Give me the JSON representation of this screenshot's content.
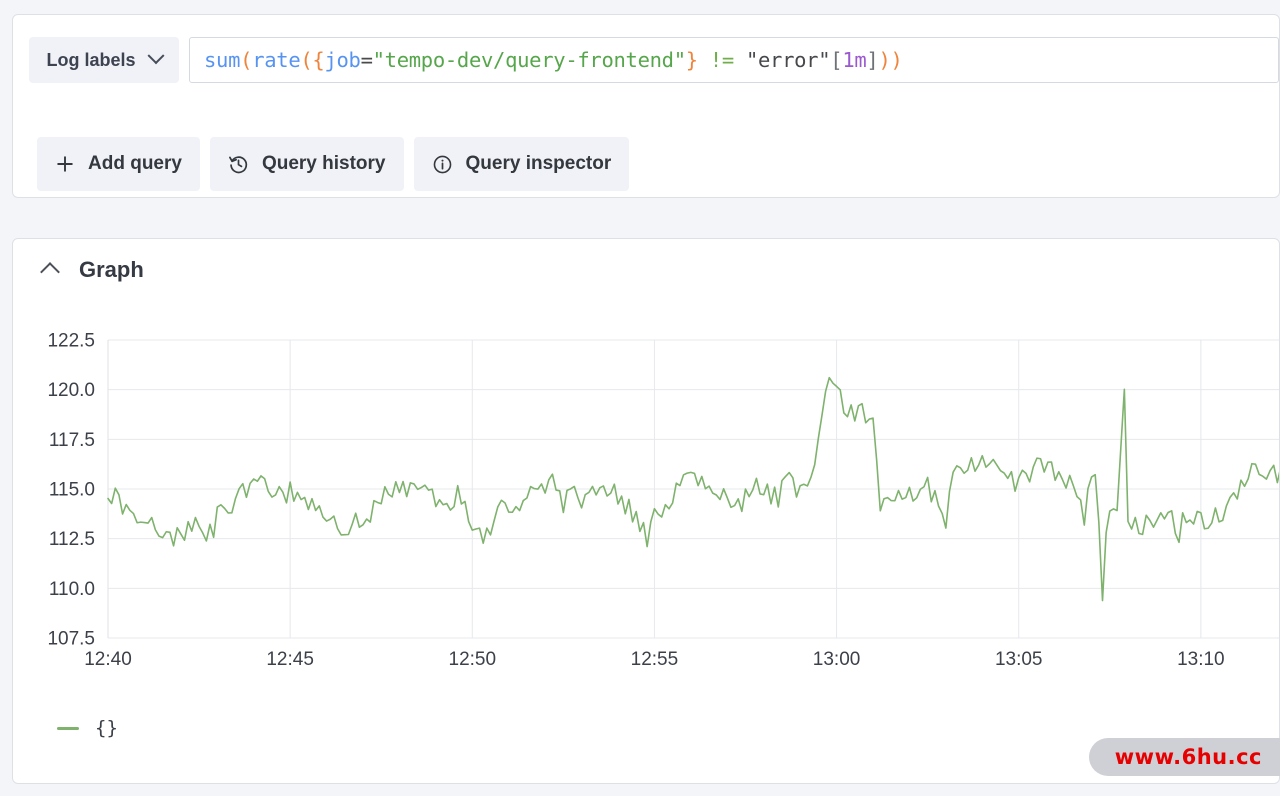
{
  "query_panel": {
    "log_labels_button": "Log labels",
    "chevron_icon": "chevron-down-icon",
    "expression": {
      "full": "sum(rate({job=\"tempo-dev/query-frontend\"} != \"error\"[1m]))",
      "tokens": {
        "sum": "sum",
        "open1": "(",
        "rate": "rate",
        "open2": "(",
        "brace_open": "{",
        "label": "job",
        "eq": "=",
        "value": "\"tempo-dev/query-frontend\"",
        "brace_close": "}",
        "neq": "!=",
        "error_str": "\"error\"",
        "bracket_open": "[",
        "duration": "1m",
        "bracket_close": "]",
        "close": "))"
      }
    },
    "buttons": [
      {
        "label": "Add query",
        "icon": "plus-icon"
      },
      {
        "label": "Query history",
        "icon": "history-clock-icon"
      },
      {
        "label": "Query inspector",
        "icon": "info-circle-icon"
      }
    ]
  },
  "graph_panel": {
    "title": "Graph",
    "collapse_icon": "chevron-up-icon",
    "legend": [
      {
        "label": "{}",
        "color": "#7eb26d"
      }
    ]
  },
  "watermark": {
    "text": "www.6hu.cc",
    "color": "#e60000"
  },
  "chart_data": {
    "type": "line",
    "title": "Graph",
    "xlabel": "",
    "ylabel": "",
    "x_tick_labels": [
      "12:40",
      "12:45",
      "12:50",
      "12:55",
      "13:00",
      "13:05",
      "13:10"
    ],
    "x_tick_minutes": [
      760,
      765,
      770,
      775,
      780,
      785,
      790
    ],
    "xlim": [
      760,
      792.2
    ],
    "y_tick_labels": [
      "122.5",
      "120.0",
      "117.5",
      "115.0",
      "112.5",
      "110.0",
      "107.5"
    ],
    "y_ticks": [
      122.5,
      120.0,
      117.5,
      115.0,
      112.5,
      110.0,
      107.5
    ],
    "ylim": [
      107.5,
      122.5
    ],
    "grid": true,
    "legend_position": "bottom-left",
    "series": [
      {
        "name": "{}",
        "color": "#7eb26d",
        "line_width": 1.6,
        "sample_interval_minutes": 0.1,
        "note": "Noisy rate series sampled every ~6s from 12:40 to 13:12",
        "control_points": [
          {
            "t": 760.0,
            "v": 115.0
          },
          {
            "t": 760.3,
            "v": 114.3
          },
          {
            "t": 760.7,
            "v": 113.9
          },
          {
            "t": 761.1,
            "v": 113.6
          },
          {
            "t": 761.5,
            "v": 112.9
          },
          {
            "t": 761.9,
            "v": 112.6
          },
          {
            "t": 762.3,
            "v": 113.0
          },
          {
            "t": 762.8,
            "v": 113.2
          },
          {
            "t": 763.3,
            "v": 114.2
          },
          {
            "t": 763.8,
            "v": 115.1
          },
          {
            "t": 764.2,
            "v": 115.4
          },
          {
            "t": 764.6,
            "v": 114.6
          },
          {
            "t": 765.0,
            "v": 114.9
          },
          {
            "t": 765.5,
            "v": 114.5
          },
          {
            "t": 766.0,
            "v": 113.9
          },
          {
            "t": 766.4,
            "v": 112.9
          },
          {
            "t": 766.9,
            "v": 113.6
          },
          {
            "t": 767.3,
            "v": 114.0
          },
          {
            "t": 767.7,
            "v": 115.1
          },
          {
            "t": 768.0,
            "v": 114.7
          },
          {
            "t": 768.4,
            "v": 115.4
          },
          {
            "t": 768.8,
            "v": 114.9
          },
          {
            "t": 769.2,
            "v": 114.2
          },
          {
            "t": 769.6,
            "v": 114.6
          },
          {
            "t": 770.0,
            "v": 113.4
          },
          {
            "t": 770.3,
            "v": 112.6
          },
          {
            "t": 770.8,
            "v": 113.9
          },
          {
            "t": 771.3,
            "v": 114.2
          },
          {
            "t": 771.8,
            "v": 115.0
          },
          {
            "t": 772.2,
            "v": 115.3
          },
          {
            "t": 772.7,
            "v": 114.7
          },
          {
            "t": 773.1,
            "v": 114.3
          },
          {
            "t": 773.6,
            "v": 115.2
          },
          {
            "t": 774.0,
            "v": 114.6
          },
          {
            "t": 774.4,
            "v": 113.7
          },
          {
            "t": 774.8,
            "v": 112.5
          },
          {
            "t": 775.1,
            "v": 114.0
          },
          {
            "t": 775.6,
            "v": 114.8
          },
          {
            "t": 776.0,
            "v": 115.5
          },
          {
            "t": 776.4,
            "v": 115.2
          },
          {
            "t": 776.9,
            "v": 114.5
          },
          {
            "t": 777.3,
            "v": 114.0
          },
          {
            "t": 777.8,
            "v": 115.3
          },
          {
            "t": 778.2,
            "v": 114.8
          },
          {
            "t": 778.7,
            "v": 115.3
          },
          {
            "t": 779.1,
            "v": 115.0
          },
          {
            "t": 779.4,
            "v": 116.2
          },
          {
            "t": 779.6,
            "v": 118.9
          },
          {
            "t": 779.8,
            "v": 120.4
          },
          {
            "t": 779.95,
            "v": 120.5
          },
          {
            "t": 780.1,
            "v": 119.6
          },
          {
            "t": 780.3,
            "v": 119.2
          },
          {
            "t": 780.5,
            "v": 118.6
          },
          {
            "t": 780.7,
            "v": 118.9
          },
          {
            "t": 780.9,
            "v": 118.3
          },
          {
            "t": 781.05,
            "v": 118.4
          },
          {
            "t": 781.15,
            "v": 114.5
          },
          {
            "t": 781.3,
            "v": 114.2
          },
          {
            "t": 781.7,
            "v": 115.1
          },
          {
            "t": 782.1,
            "v": 114.6
          },
          {
            "t": 782.5,
            "v": 115.1
          },
          {
            "t": 782.9,
            "v": 114.3
          },
          {
            "t": 783.3,
            "v": 115.6
          },
          {
            "t": 783.7,
            "v": 116.4
          },
          {
            "t": 784.0,
            "v": 116.6
          },
          {
            "t": 784.4,
            "v": 116.3
          },
          {
            "t": 784.8,
            "v": 115.3
          },
          {
            "t": 785.1,
            "v": 115.5
          },
          {
            "t": 785.5,
            "v": 116.1
          },
          {
            "t": 785.8,
            "v": 116.4
          },
          {
            "t": 786.1,
            "v": 115.6
          },
          {
            "t": 786.4,
            "v": 115.2
          },
          {
            "t": 786.7,
            "v": 114.9
          },
          {
            "t": 787.0,
            "v": 115.4
          },
          {
            "t": 787.15,
            "v": 115.3
          },
          {
            "t": 787.3,
            "v": 109.4
          },
          {
            "t": 787.45,
            "v": 114.5
          },
          {
            "t": 787.7,
            "v": 113.9
          },
          {
            "t": 787.9,
            "v": 120.0
          },
          {
            "t": 788.0,
            "v": 113.2
          },
          {
            "t": 788.3,
            "v": 112.9
          },
          {
            "t": 788.7,
            "v": 113.4
          },
          {
            "t": 789.1,
            "v": 113.8
          },
          {
            "t": 789.5,
            "v": 113.5
          },
          {
            "t": 789.9,
            "v": 113.3
          },
          {
            "t": 790.3,
            "v": 113.6
          },
          {
            "t": 790.7,
            "v": 114.0
          },
          {
            "t": 791.0,
            "v": 114.9
          },
          {
            "t": 791.3,
            "v": 115.8
          },
          {
            "t": 791.6,
            "v": 116.5
          },
          {
            "t": 791.9,
            "v": 115.6
          },
          {
            "t": 792.2,
            "v": 115.9
          }
        ]
      }
    ]
  }
}
